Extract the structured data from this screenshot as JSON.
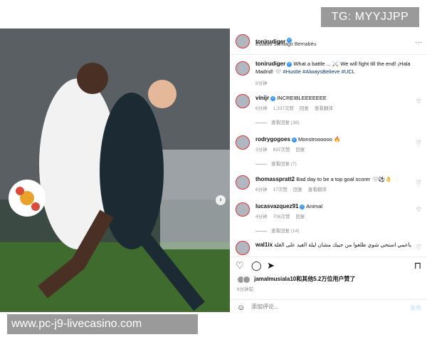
{
  "watermark": {
    "tg": "TG: MYYJJPP",
    "url": "www.pc-j9-livecasino.com"
  },
  "header": {
    "username": "tonirudiger",
    "location": "Estadio Santiago Bernabéu",
    "more": "..."
  },
  "caption": {
    "username": "tonirudiger",
    "text": "What a battle ... ⚔️ We will fight till the end! ¡Hala Madrid! 🤍",
    "tags": "#Hustle #AlwaysBelieve #UCL",
    "time": "8分钟"
  },
  "comments": [
    {
      "username": "vinijr",
      "text": "INCREIBLEEEEEEE",
      "time": "6分钟",
      "likes": "1,337次赞",
      "reply": "回复",
      "translate": "查看翻译",
      "view_replies": "查看回复 (38)"
    },
    {
      "username": "rodrygogoes",
      "text": "Monstroooooo 🔥",
      "time": "3分钟",
      "likes": "637次赞",
      "reply": "回复",
      "translate": "",
      "view_replies": "查看回复 (7)"
    },
    {
      "username": "thomasspratt2",
      "text": "Bad day to be a top goal scorer 🤍⚽👌",
      "time": "6分钟",
      "likes": "17次赞",
      "reply": "回复",
      "translate": "查看翻译",
      "view_replies": ""
    },
    {
      "username": "lucasvazquez91",
      "text": "Animal",
      "time": "4分钟",
      "likes": "706次赞",
      "reply": "回复",
      "translate": "",
      "view_replies": "查看回复 (14)"
    },
    {
      "username": "wal1ix",
      "text": "ياعمي استحي شوي طلعوا من جيبك مشان ليلة العيد على الغلة",
      "time": "",
      "likes": "",
      "reply": "",
      "translate": "",
      "view_replies": ""
    }
  ],
  "likes_line": {
    "user": "jamalmusiala10",
    "rest": "和其他5.2万位用户赞了"
  },
  "post_time": "8分钟前",
  "composer": {
    "placeholder": "添加评论...",
    "post_label": "发布"
  },
  "colors": {
    "link": "#00376b",
    "verified": "#3897f0",
    "muted": "#8e8e8e"
  }
}
